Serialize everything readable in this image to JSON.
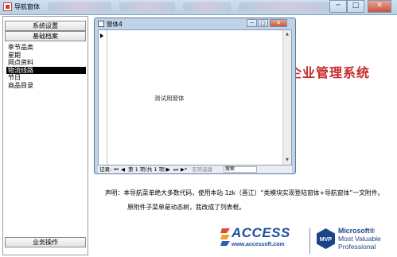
{
  "window": {
    "title": "导航窗体",
    "controls": {
      "minimize": "─",
      "maximize": "□",
      "close": "✕"
    }
  },
  "sidebar": {
    "top_buttons": [
      "系统设置",
      "基础档案"
    ],
    "items": [
      {
        "label": "季节品类",
        "selected": false
      },
      {
        "label": "星期",
        "selected": false
      },
      {
        "label": "网点资料",
        "selected": false
      },
      {
        "label": "物流线路",
        "selected": true
      },
      {
        "label": "节日",
        "selected": false
      },
      {
        "label": "商品目录",
        "selected": false
      }
    ],
    "bottom_button": "业务操作"
  },
  "main": {
    "banner": "企业管理系统",
    "declaration": {
      "line1": "声明：本导航菜单绝大多数代码，使用本站 1zk（晋江）“类模块实现登陆窗体+导航窗体”一文附件。",
      "line2": "原附件子菜单是动态树，我改成了列表框。"
    }
  },
  "form_window": {
    "title": "窗体4",
    "controls": {
      "minimize": "─",
      "maximize": "□",
      "close": "✕"
    },
    "body_text": "测试用窗体",
    "nav": {
      "record_label": "记录:",
      "first": "⏮",
      "prev": "◀",
      "position": "第 1 项(共 1 项)",
      "next": "▶",
      "last": "⏭",
      "new": "▶*",
      "filter": "无筛选器",
      "search_placeholder": "搜索"
    }
  },
  "logos": {
    "access": "ACCESS",
    "access_url": "www.accessoft.com",
    "mvp_badge": "MVP",
    "mvp_line1": "Microsoft®",
    "mvp_line2": "Most Valuable",
    "mvp_line3": "Professional"
  },
  "colors": {
    "banner": "#c62828",
    "logo_blue": "#1d4f9e",
    "selection": "#000000"
  }
}
